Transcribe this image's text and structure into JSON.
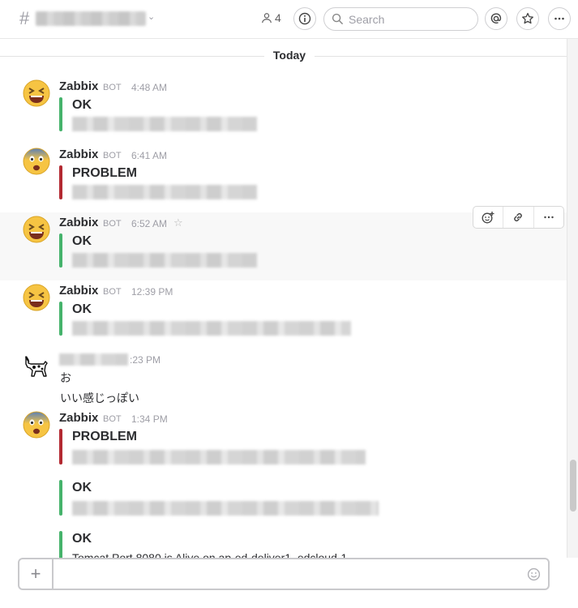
{
  "header": {
    "hash": "#",
    "member_count": "4",
    "search_placeholder": "Search"
  },
  "divider": {
    "label": "Today"
  },
  "messages": [
    {
      "name": "Zabbix",
      "badge": "BOT",
      "time": "4:48 AM",
      "att_title": "OK",
      "status": "ok",
      "avatar_icon": "laughing-face-icon"
    },
    {
      "name": "Zabbix",
      "badge": "BOT",
      "time": "6:41 AM",
      "att_title": "PROBLEM",
      "status": "problem",
      "avatar_icon": "fearful-face-icon"
    },
    {
      "name": "Zabbix",
      "badge": "BOT",
      "time": "6:52 AM",
      "att_title": "OK",
      "status": "ok",
      "avatar_icon": "laughing-face-icon"
    },
    {
      "name": "Zabbix",
      "badge": "BOT",
      "time": "12:39 PM",
      "att_title": "OK",
      "status": "ok",
      "avatar_icon": "laughing-face-icon"
    },
    {
      "time": ":23 PM",
      "lines": [
        "お",
        "いい感じっぽい"
      ],
      "avatar_icon": "dog-icon"
    },
    {
      "name": "Zabbix",
      "badge": "BOT",
      "time": "1:34 PM",
      "avatar_icon": "fearful-face-icon",
      "attachments": [
        {
          "title": "PROBLEM",
          "status": "problem"
        },
        {
          "title": "OK",
          "status": "ok"
        },
        {
          "title": "OK",
          "status": "ok",
          "text": "Tomcat Port 8080 is Alive on ap-ed-deliver1_edcloud-1"
        }
      ]
    }
  ],
  "colors": {
    "ok": "#46b36c",
    "problem": "#b32a32"
  }
}
